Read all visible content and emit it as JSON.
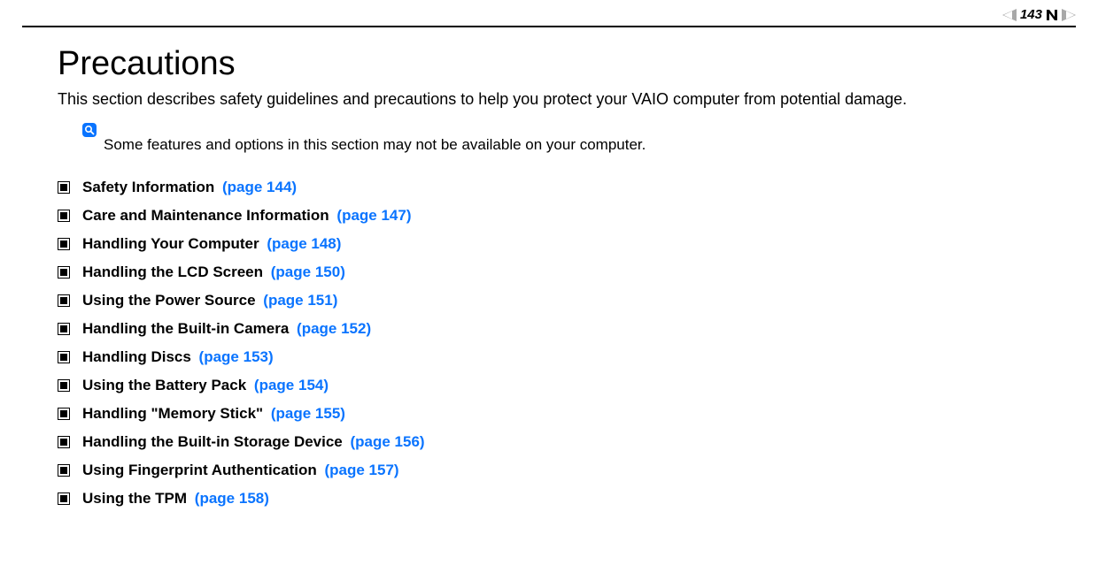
{
  "header": {
    "page_number": "143"
  },
  "title": "Precautions",
  "intro": "This section describes safety guidelines and precautions to help you protect your VAIO computer from potential damage.",
  "note": "Some features and options in this section may not be available on your computer.",
  "toc": [
    {
      "label": "Safety Information",
      "page": "(page 144)"
    },
    {
      "label": "Care and Maintenance Information",
      "page": "(page 147)"
    },
    {
      "label": "Handling Your Computer",
      "page": "(page 148)"
    },
    {
      "label": "Handling the LCD Screen",
      "page": "(page 150)"
    },
    {
      "label": "Using the Power Source",
      "page": "(page 151)"
    },
    {
      "label": "Handling the Built-in Camera",
      "page": "(page 152)"
    },
    {
      "label": "Handling Discs",
      "page": "(page 153)"
    },
    {
      "label": "Using the Battery Pack",
      "page": "(page 154)"
    },
    {
      "label": "Handling \"Memory Stick\"",
      "page": "(page 155)"
    },
    {
      "label": "Handling the Built-in Storage Device",
      "page": "(page 156)"
    },
    {
      "label": "Using Fingerprint Authentication",
      "page": "(page 157)"
    },
    {
      "label": "Using the TPM",
      "page": "(page 158)"
    }
  ]
}
